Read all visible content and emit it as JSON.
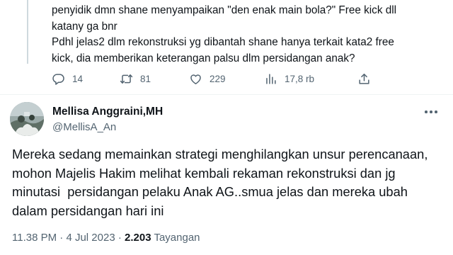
{
  "previous_tweet": {
    "text": "penyidik dmn shane menyampaikan \"den enak main bola?\" Free kick dll\nkatany ga bnr\nPdhl jelas2 dlm rekonstruksi yg dibantah shane hanya terkait kata2 free\nkick, dia memberikan keterangan palsu dlm persidangan anak?",
    "actions": {
      "replies": "14",
      "retweets": "81",
      "likes": "229",
      "views": "17,8 rb"
    },
    "icons": [
      "reply-icon",
      "retweet-icon",
      "like-icon",
      "views-icon",
      "share-icon"
    ]
  },
  "tweet": {
    "author": {
      "display_name": "Mellisa Anggraini,MH",
      "handle": "@MellisA_An"
    },
    "text": "Mereka sedang memainkan strategi menghilangkan unsur perencanaan,\nmohon Majelis Hakim melihat kembali rekaman rekonstruksi dan jg\nminutasi  persidangan pelaku Anak AG..smua jelas dan mereka ubah\ndalam persidangan hari ini",
    "time": "11.38 PM",
    "separator": "·",
    "date": "4 Jul 2023",
    "views_count": "2.203",
    "views_label": "Tayangan"
  },
  "colors": {
    "text_primary": "#0f1419",
    "text_secondary": "#536471",
    "divider": "#eff3f4",
    "thread_line": "#cfd9de"
  }
}
